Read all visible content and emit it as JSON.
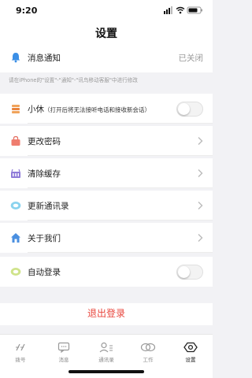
{
  "status": {
    "time": "9:20"
  },
  "header": {
    "title": "设置"
  },
  "notification": {
    "label": "消息通知",
    "value": "已关闭"
  },
  "hint": "请在iPhone的\"设置\"-\"通知\"-\"讯鸟移动客服\"中进行修改",
  "rows": {
    "rest": {
      "label": "小休",
      "note": "（打开后将无法接听电话和接收新会话）",
      "enabled": false
    },
    "password": {
      "label": "更改密码"
    },
    "cache": {
      "label": "清除缓存"
    },
    "contacts": {
      "label": "更新通讯录"
    },
    "about": {
      "label": "关于我们"
    },
    "autologin": {
      "label": "自动登录",
      "enabled": false
    }
  },
  "logout": {
    "label": "退出登录"
  },
  "tabs": [
    {
      "label": "拨号",
      "icon": "dialpad-icon"
    },
    {
      "label": "消息",
      "icon": "message-icon"
    },
    {
      "label": "通讯录",
      "icon": "contacts-icon"
    },
    {
      "label": "工作",
      "icon": "work-icon"
    },
    {
      "label": "设置",
      "icon": "settings-icon"
    }
  ],
  "colors": {
    "accent_red": "#e8453c",
    "notify_icon": "#3b8fe6",
    "muted_text": "#999999",
    "background": "#f2f2f5"
  }
}
